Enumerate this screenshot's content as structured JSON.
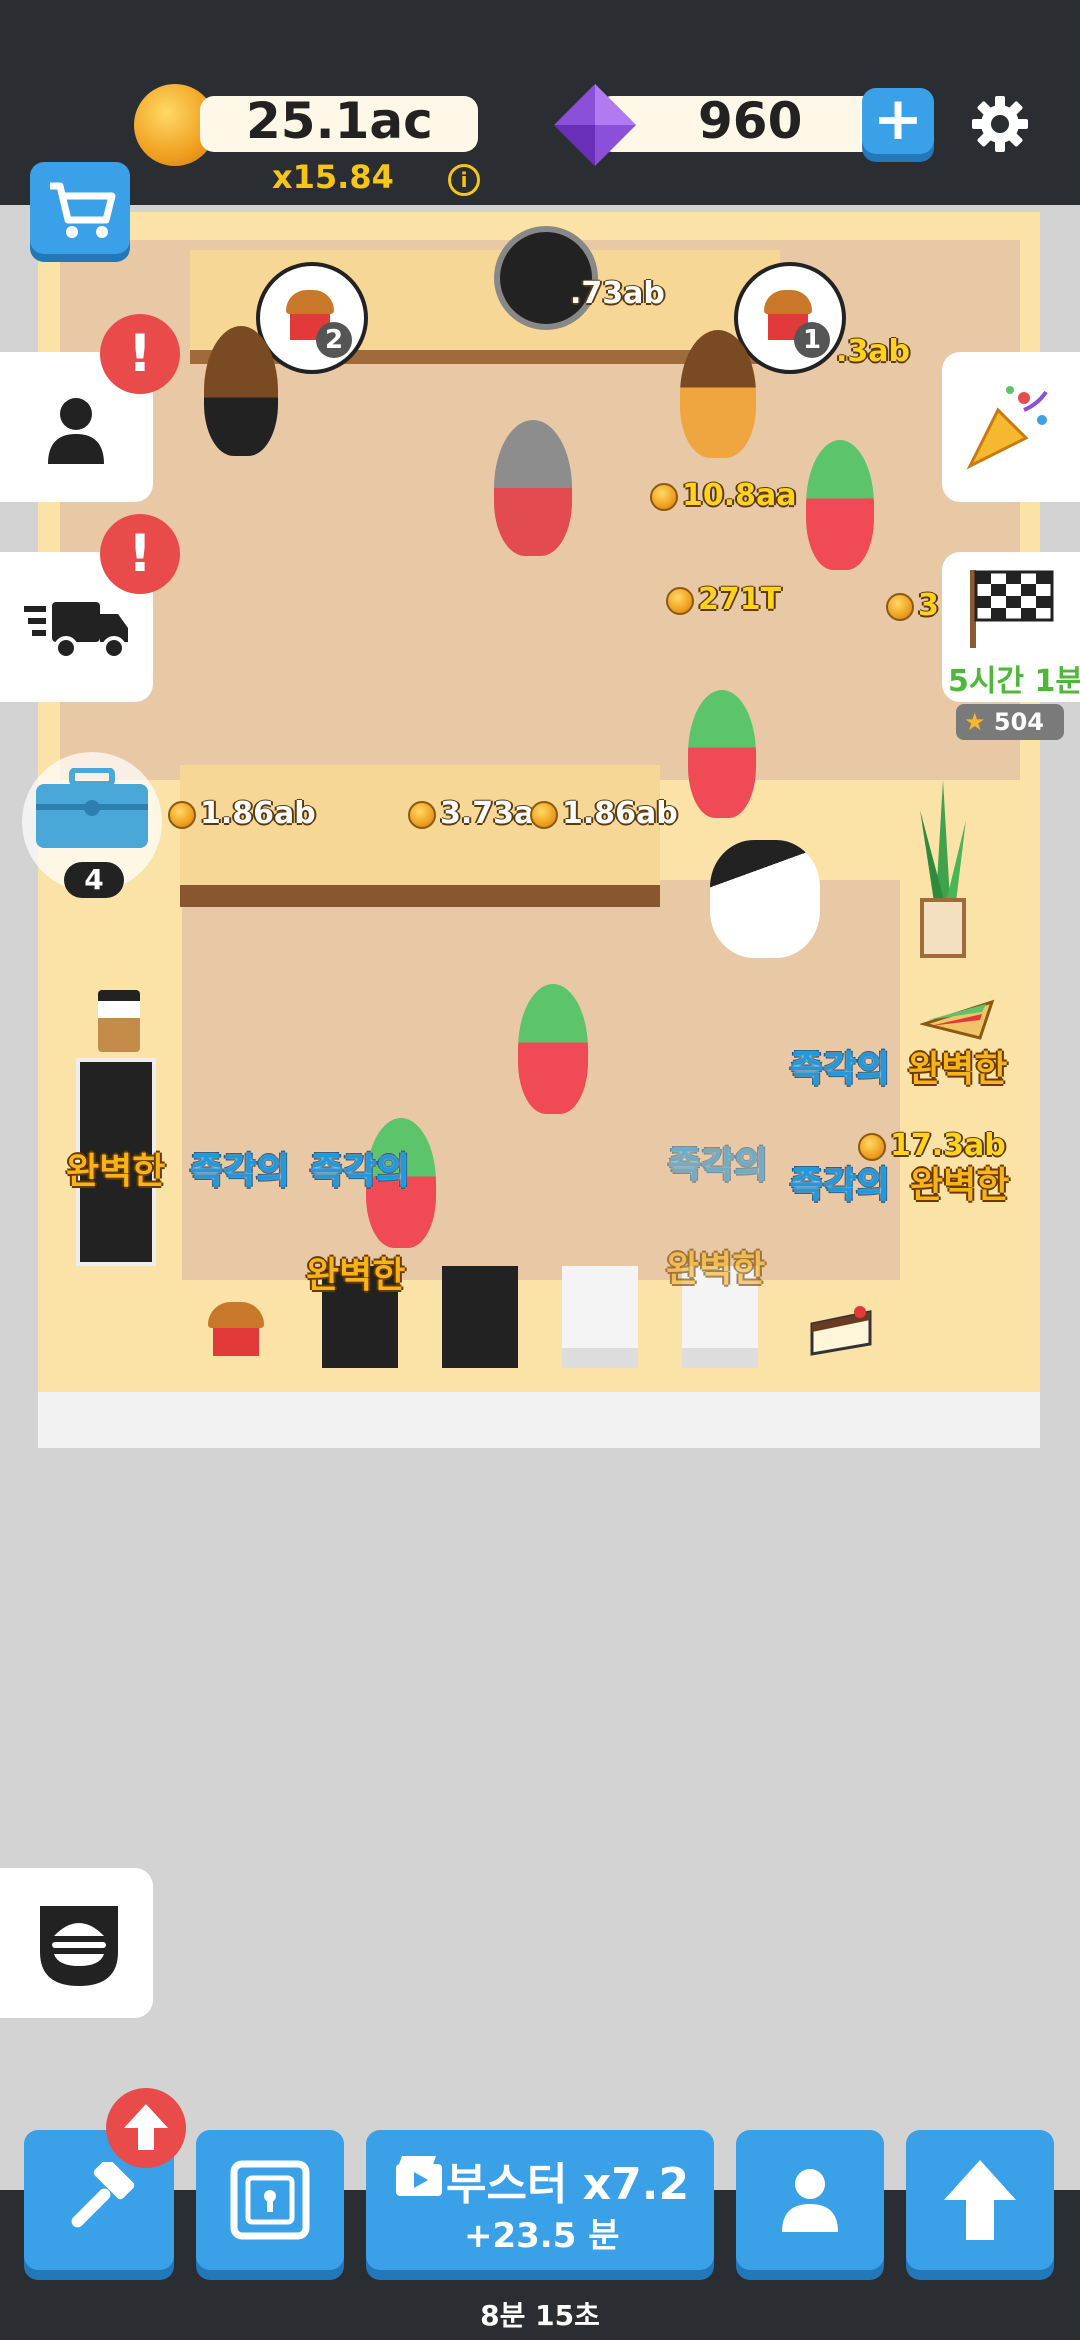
{
  "header": {
    "coins": "25.1ac",
    "multiplier": "x15.84",
    "info_icon": "i",
    "gems": "960",
    "add_label": "+",
    "icons": {
      "coin": "coin-icon",
      "gem": "purple-gem-icon",
      "settings": "gear-icon",
      "shop": "shopping-cart-icon"
    }
  },
  "side_left": {
    "staff_alert": "!",
    "delivery_alert": "!",
    "chest_count": "4"
  },
  "side_right": {
    "event_timer": "5시간 1분",
    "stars": "504"
  },
  "orders": {
    "bubble_left_count": "2",
    "bubble_right_count": "1"
  },
  "money_labels": {
    "top_center": ".73ab",
    "top_right": ".3ab",
    "queue_1": "10.8aa",
    "queue_2": "271T",
    "right_edge": "3",
    "counter_1": "1.86ab",
    "counter_2": "3.73a",
    "counter_3": "1.86ab",
    "kitchen_right": "17.3ab"
  },
  "quality_words": {
    "instant": "즉각의",
    "perfect": "완벽한"
  },
  "bottom": {
    "boost_title": "부스터 x7.2",
    "boost_sub": "+23.5 분",
    "timer": "8분 15초",
    "icons": {
      "hammer": "hammer-icon",
      "vault": "vault-icon",
      "manager": "person-icon",
      "upgrade": "up-arrow-icon"
    }
  },
  "colors": {
    "accent_blue": "#3aa0e8",
    "alert_red": "#e94b4b",
    "gold": "#f5c518",
    "bar": "#2a2d32"
  }
}
